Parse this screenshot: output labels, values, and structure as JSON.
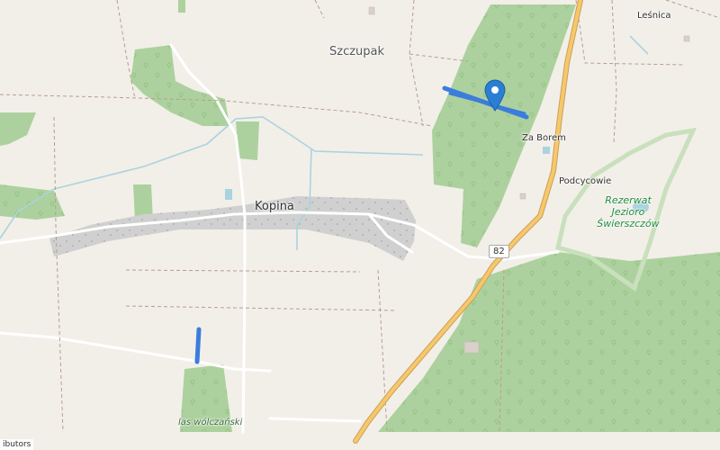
{
  "map": {
    "labels": {
      "szczupak": "Szczupak",
      "lesnica": "Leśnica",
      "za_borem": "Za Borem",
      "podcycowie": "Podcycowie",
      "kopina": "Kopina",
      "reserve_line1": "Rezerwat",
      "reserve_line2": "Jezioro",
      "reserve_line3": "Świerszczów",
      "las_wolczanski": "las wólczański"
    },
    "road_shield": "82",
    "attribution": "ibutors",
    "colors": {
      "background": "#f2efe9",
      "forest": "#add19e",
      "village": "#d0d0d0",
      "water": "#aad3df",
      "main_road": "#f7c76b",
      "highlight": "#3b7ddd",
      "reserve_border": "#c9e0bd"
    },
    "marker_icon": "map-pin-icon"
  }
}
